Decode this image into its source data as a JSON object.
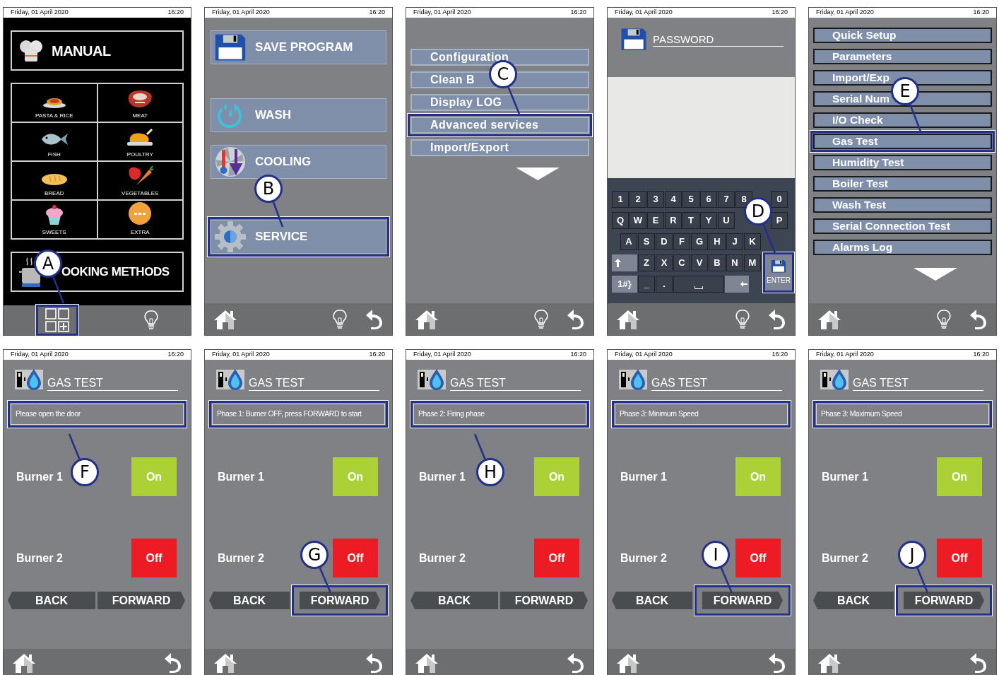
{
  "panels": [
    {
      "kind": "manual",
      "date": "Friday, 01 April 2020",
      "time": "16:20",
      "title": "MANUAL",
      "categories": [
        "PASTA & RICE",
        "MEAT",
        "FISH",
        "POULTRY",
        "BREAD",
        "VEGETABLES",
        "SWEETS",
        "EXTRA"
      ],
      "methods": "OOKING METHODS",
      "nav_highlighted": true,
      "callout": "A"
    },
    {
      "kind": "big_menu",
      "date": "Friday, 01 April 2020",
      "time": "16:20",
      "items": [
        {
          "label": "SAVE PROGRAM",
          "kind": "save",
          "highlighted": false
        },
        {
          "label": "WASH",
          "kind": "wash",
          "highlighted": false
        },
        {
          "label": "COOLING",
          "kind": "cooling",
          "highlighted": false
        },
        {
          "label": "SERVICE",
          "kind": "service",
          "highlighted": true
        }
      ],
      "callout": "B"
    },
    {
      "kind": "list",
      "date": "Friday, 01 April 2020",
      "time": "16:20",
      "items": [
        {
          "label": "Configuration",
          "highlighted": false
        },
        {
          "label": "Clean B",
          "highlighted": false
        },
        {
          "label": "Display LOG",
          "highlighted": false
        },
        {
          "label": "Advanced services",
          "highlighted": true
        },
        {
          "label": "Import/Export",
          "highlighted": false
        }
      ],
      "callout": "C"
    },
    {
      "kind": "password",
      "date": "Friday, 01 April 2020",
      "time": "16:20",
      "title": "PASSWORD",
      "keys": [
        [
          "1",
          "2",
          "3",
          "4",
          "5",
          "6",
          "7",
          "8",
          "0"
        ],
        [
          "Q",
          "W",
          "E",
          "R",
          "T",
          "Y",
          "U",
          "P"
        ],
        [
          "A",
          "S",
          "D",
          "F",
          "G",
          "H",
          "J",
          "K"
        ],
        [
          "Z",
          "X",
          "C",
          "V",
          "B",
          "N",
          "M"
        ]
      ],
      "symbols_key": "1#}",
      "underscore_key": "_",
      "dot_key": ".",
      "enter_label": "ENTER",
      "enter_highlighted": true,
      "callout": "D"
    },
    {
      "kind": "list",
      "date": "Friday, 01 April 2020",
      "time": "16:20",
      "items": [
        {
          "label": "Quick Setup",
          "highlighted": false
        },
        {
          "label": "Parameters",
          "highlighted": false
        },
        {
          "label": "Import/Exp",
          "highlighted": false
        },
        {
          "label": "Serial Num",
          "highlighted": false
        },
        {
          "label": "I/O Check",
          "highlighted": false
        },
        {
          "label": "Gas Test",
          "highlighted": true
        },
        {
          "label": "Humidity Test",
          "highlighted": false
        },
        {
          "label": "Boiler Test",
          "highlighted": false
        },
        {
          "label": "Wash Test",
          "highlighted": false
        },
        {
          "label": "Serial Connection Test",
          "highlighted": false
        },
        {
          "label": "Alarms Log",
          "highlighted": false
        }
      ],
      "callout": "E"
    },
    {
      "kind": "gas_test",
      "date": "Friday, 01 April 2020",
      "time": "16:20",
      "title": "GAS TEST",
      "message": "Please open the door",
      "message_highlighted": true,
      "burners": [
        {
          "name": "Burner 1",
          "status": "On",
          "on": true
        },
        {
          "name": "Burner 2",
          "status": "Off",
          "on": false
        }
      ],
      "back": "BACK",
      "forward": "FORWARD",
      "forward_highlighted": false,
      "callout": "F"
    },
    {
      "kind": "gas_test",
      "date": "Friday, 01 April 2020",
      "time": "16:20",
      "title": "GAS TEST",
      "message": "Phase 1: Burner OFF, press FORWARD to start",
      "message_highlighted": true,
      "burners": [
        {
          "name": "Burner 1",
          "status": "On",
          "on": true
        },
        {
          "name": "Burner 2",
          "status": "Off",
          "on": false
        }
      ],
      "back": "BACK",
      "forward": "FORWARD",
      "forward_highlighted": true,
      "callout": "G"
    },
    {
      "kind": "gas_test",
      "date": "Friday, 01 April 2020",
      "time": "16:20",
      "title": "GAS TEST",
      "message": "Phase 2: Firing phase",
      "message_highlighted": true,
      "burners": [
        {
          "name": "Burner 1",
          "status": "On",
          "on": true
        },
        {
          "name": "Burner 2",
          "status": "Off",
          "on": false
        }
      ],
      "back": "BACK",
      "forward": "FORWARD",
      "forward_highlighted": false,
      "callout": "H"
    },
    {
      "kind": "gas_test",
      "date": "Friday, 01 April 2020",
      "time": "16:20",
      "title": "GAS TEST",
      "message": "Phase 3: Minimum Speed",
      "message_highlighted": true,
      "burners": [
        {
          "name": "Burner 1",
          "status": "On",
          "on": true
        },
        {
          "name": "Burner 2",
          "status": "Off",
          "on": false
        }
      ],
      "back": "BACK",
      "forward": "FORWARD",
      "forward_highlighted": true,
      "callout": "I"
    },
    {
      "kind": "gas_test",
      "date": "Friday, 01 April 2020",
      "time": "16:20",
      "title": "GAS TEST",
      "message": "Phase 3: Maximum Speed",
      "message_highlighted": true,
      "burners": [
        {
          "name": "Burner 1",
          "status": "On",
          "on": true
        },
        {
          "name": "Burner 2",
          "status": "Off",
          "on": false
        }
      ],
      "back": "BACK",
      "forward": "FORWARD",
      "forward_highlighted": true,
      "callout": "J"
    }
  ]
}
